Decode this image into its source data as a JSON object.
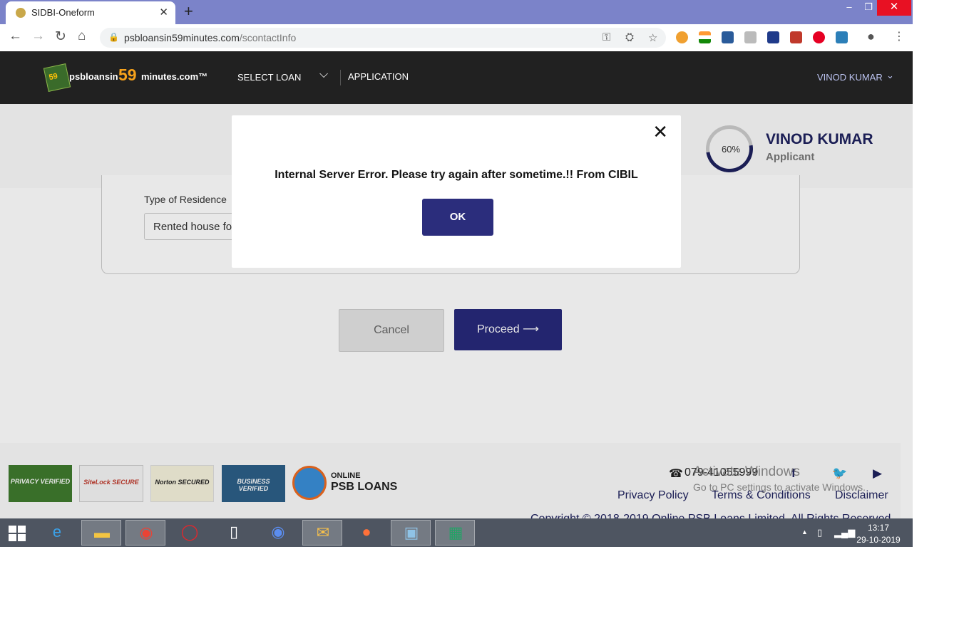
{
  "browser": {
    "tab_title": "SIDBI-Oneform",
    "tab_close": "✕",
    "new_tab": "+",
    "url_domain": "psbloansin59minutes.com",
    "url_path": "/scontactInfo",
    "window_controls": {
      "minimize": "–",
      "maximize": "❐",
      "close": "✕"
    }
  },
  "header": {
    "logo_badge": "59",
    "logo_prefix": "psbloansin",
    "logo_number": "59",
    "logo_suffix": "minutes.com™",
    "nav": {
      "select_loan": "SELECT LOAN",
      "application": "APPLICATION"
    },
    "user_menu": "VINOD KUMAR"
  },
  "profile": {
    "progress_label": "60%",
    "progress_fraction": 0.6,
    "name": "VINOD KUMAR",
    "role": "Applicant"
  },
  "form": {
    "residence_label": "Type of Residence",
    "residence_value": "Rented house fo"
  },
  "actions": {
    "cancel": "Cancel",
    "proceed": "Proceed ⟶"
  },
  "modal": {
    "message": "Internal Server Error. Please try again after sometime.!! From CIBIL",
    "ok": "OK",
    "close": "✕"
  },
  "footer": {
    "seals": {
      "privacy": "PRIVACY VERIFIED",
      "sitelock": "SiteLock SECURE",
      "norton": "Norton SECURED",
      "business": "BUSINESS VERIFIED"
    },
    "psb_online": "ONLINE",
    "psb_loans": "PSB LOANS",
    "phone": "079-41055999",
    "links": {
      "privacy": "Privacy Policy",
      "terms": "Terms & Conditions",
      "disclaimer": "Disclaimer"
    },
    "copyright": "Copyright © 2018-2019 Online PSB Loans Limited. All Rights Reserved",
    "watermark_title": "Activate Windows",
    "watermark_sub": "Go to PC settings to activate Windows."
  },
  "taskbar": {
    "time": "13:17",
    "date": "29-10-2019"
  },
  "colors": {
    "tabstrip": "#7b83c9",
    "header_bg": "#212121",
    "brand_navy": "#27297a",
    "logo_orange": "#f7a21b",
    "taskbar": "#4e5561"
  },
  "icons": [
    "back-icon",
    "forward-icon",
    "reload-icon",
    "home-icon",
    "lock-icon",
    "key-icon",
    "translate-icon",
    "star-icon",
    "profile-icon",
    "menu-icon",
    "chevron-down-icon",
    "close-icon",
    "arrow-right-icon",
    "phone-icon",
    "facebook-icon",
    "twitter-icon",
    "youtube-icon"
  ]
}
